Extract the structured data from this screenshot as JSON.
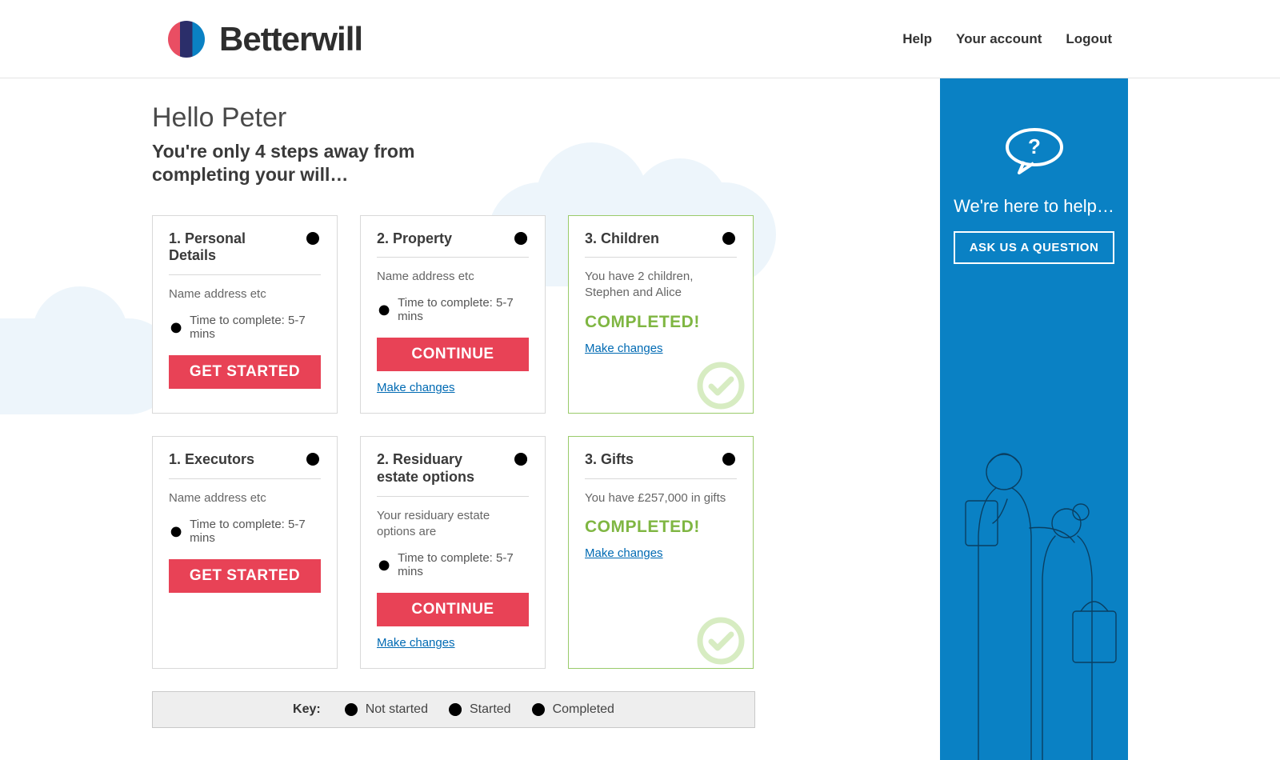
{
  "brand": {
    "name": "Betterwill"
  },
  "nav": {
    "help": "Help",
    "account": "Your account",
    "logout": "Logout"
  },
  "greeting": "Hello Peter",
  "subhead": "You're only 4 steps away from completing your will…",
  "cards": [
    {
      "title": "1. Personal Details",
      "desc": "Name address etc",
      "time": "Time to complete: 5-7 mins",
      "cta": "GET STARTED",
      "status": "not"
    },
    {
      "title": "2. Property",
      "desc": "Name address etc",
      "time": "Time to complete: 5-7 mins",
      "cta": "CONTINUE",
      "change": "Make changes",
      "status": "start"
    },
    {
      "title": "3. Children",
      "desc": "You have 2 children, Stephen and Alice",
      "completed": "COMPLETED!",
      "change": "Make changes",
      "status": "done"
    },
    {
      "title": "1. Executors",
      "desc": "Name address etc",
      "time": "Time to complete: 5-7 mins",
      "cta": "GET STARTED",
      "status": "not"
    },
    {
      "title": "2. Residuary estate options",
      "desc": "Your residuary estate options are",
      "time": "Time to complete: 5-7 mins",
      "cta": "CONTINUE",
      "change": "Make changes",
      "status": "start"
    },
    {
      "title": "3. Gifts",
      "desc": "You have £257,000 in gifts",
      "completed": "COMPLETED!",
      "change": "Make changes",
      "status": "done"
    }
  ],
  "key": {
    "label": "Key:",
    "not": "Not started",
    "started": "Started",
    "completed": "Completed"
  },
  "sidebar": {
    "tagline": "We're here to help…",
    "ask": "ASK US A QUESTION"
  }
}
